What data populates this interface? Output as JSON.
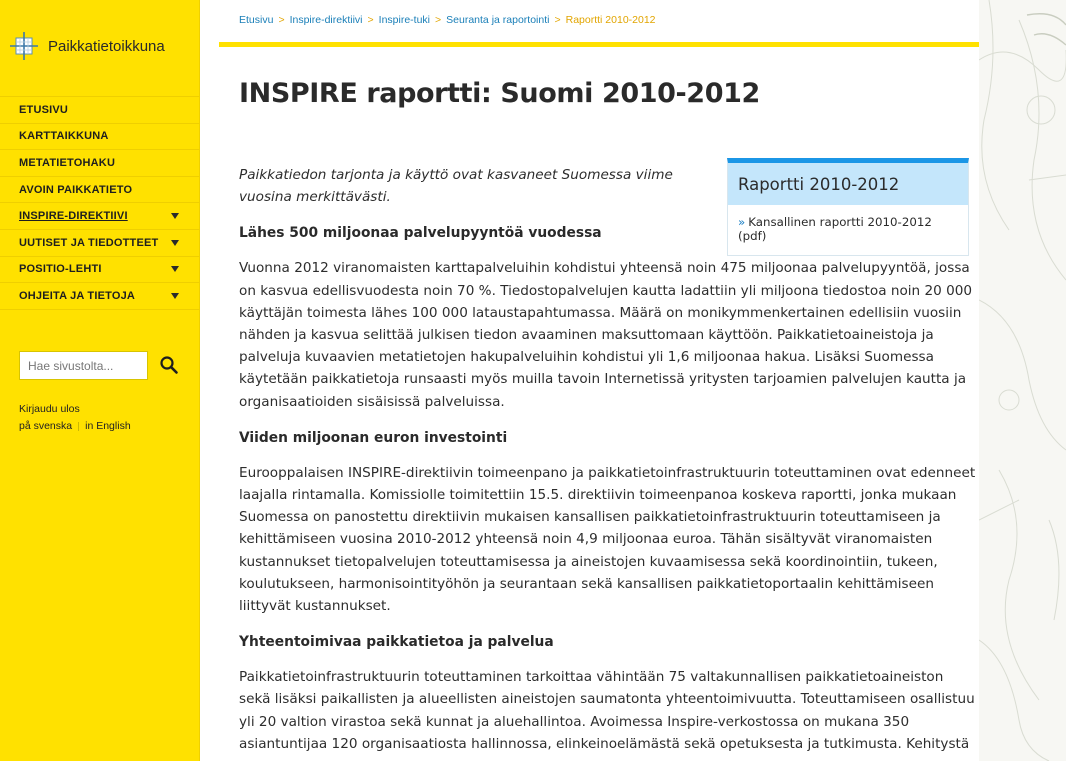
{
  "brand": {
    "name": "Paikkatietoikkuna",
    "accent": "#1b96e6"
  },
  "nav": {
    "items": [
      {
        "label": "ETUSIVU",
        "caret": false,
        "active": false
      },
      {
        "label": "KARTTAIKKUNA",
        "caret": false,
        "active": false
      },
      {
        "label": "METATIETOHAKU",
        "caret": false,
        "active": false
      },
      {
        "label": "AVOIN PAIKKATIETO",
        "caret": false,
        "active": false
      },
      {
        "label": "INSPIRE-DIREKTIIVI",
        "caret": true,
        "active": true
      },
      {
        "label": "UUTISET JA TIEDOTTEET",
        "caret": true,
        "active": false
      },
      {
        "label": "POSITIO-LEHTI",
        "caret": true,
        "active": false
      },
      {
        "label": "OHJEITA JA TIETOJA",
        "caret": true,
        "active": false
      }
    ]
  },
  "search": {
    "placeholder": "Hae sivustolta...",
    "icon": "search-icon"
  },
  "account": {
    "logout": "Kirjaudu ulos",
    "swedish": "på svenska",
    "english": "in English"
  },
  "breadcrumb": {
    "items": [
      "Etusivu",
      "Inspire-direktiivi",
      "Inspire-tuki",
      "Seuranta ja raportointi",
      "Raportti 2010-2012"
    ],
    "separator": ">"
  },
  "page": {
    "title": "INSPIRE raportti: Suomi 2010-2012",
    "intro": "Paikkatiedon tarjonta ja käyttö ovat kasvaneet Suomessa viime vuosina merkittävästi.",
    "sections": [
      {
        "heading": "Lähes 500 miljoonaa palvelupyyntöä vuodessa",
        "text": "Vuonna 2012 viranomaisten karttapalveluihin kohdistui yhteensä noin 475 miljoonaa palvelupyyntöä, jossa on kasvua edellisvuodesta noin 70 %. Tiedostopalvelujen kautta ladattiin yli miljoona tiedostoa noin 20 000 käyttäjän toimesta lähes 100 000 lataustapahtumassa. Määrä on monikymmenkertainen edellisiin vuosiin nähden ja kasvua selittää julkisen tiedon avaaminen maksuttomaan käyttöön. Paikkatietoaineistoja ja palveluja kuvaavien metatietojen hakupalveluihin kohdistui yli 1,6 miljoonaa hakua. Lisäksi Suomessa käytetään paikkatietoja runsaasti myös muilla tavoin Internetissä yritysten tarjoamien palvelujen kautta ja organisaatioiden sisäisissä palveluissa."
      },
      {
        "heading": "Viiden miljoonan euron investointi",
        "text": "Eurooppalaisen INSPIRE-direktiivin toimeenpano ja paikkatietoinfrastruktuurin toteuttaminen ovat edenneet laajalla rintamalla. Komissiolle toimitettiin 15.5. direktiivin toimeenpanoa koskeva raportti, jonka mukaan Suomessa on panostettu direktiivin mukaisen kansallisen paikkatietoinfrastruktuurin toteuttamiseen ja kehittämiseen vuosina 2010-2012 yhteensä noin 4,9 miljoonaa euroa. Tähän sisältyvät viranomaisten kustannukset tietopalvelujen toteuttamisessa ja aineistojen kuvaamisessa sekä koordinointiin, tukeen, koulutukseen, harmonisointityöhön ja seurantaan sekä kansallisen paikkatietoportaalin kehittämiseen liittyvät kustannukset."
      },
      {
        "heading": "Yhteentoimivaa paikkatietoa ja palvelua",
        "text": "Paikkatietoinfrastruktuurin toteuttaminen tarkoittaa vähintään 75 valtakunnallisen paikkatietoaineiston sekä lisäksi paikallisten ja alueellisten aineistojen saumatonta yhteentoimivuutta. Toteuttamiseen osallistuu yli 20 valtion virastoa sekä kunnat ja aluehallintoa. Avoimessa Inspire-verkostossa on mukana 350 asiantuntijaa 120 organisaatiosta hallinnossa, elinkeinoelämästä sekä opetuksesta ja tutkimusta. Kehitystä"
      }
    ]
  },
  "report_box": {
    "title": "Raportti 2010-2012",
    "bullet": "»",
    "link": "Kansallinen raportti 2010-2012 (pdf)"
  }
}
